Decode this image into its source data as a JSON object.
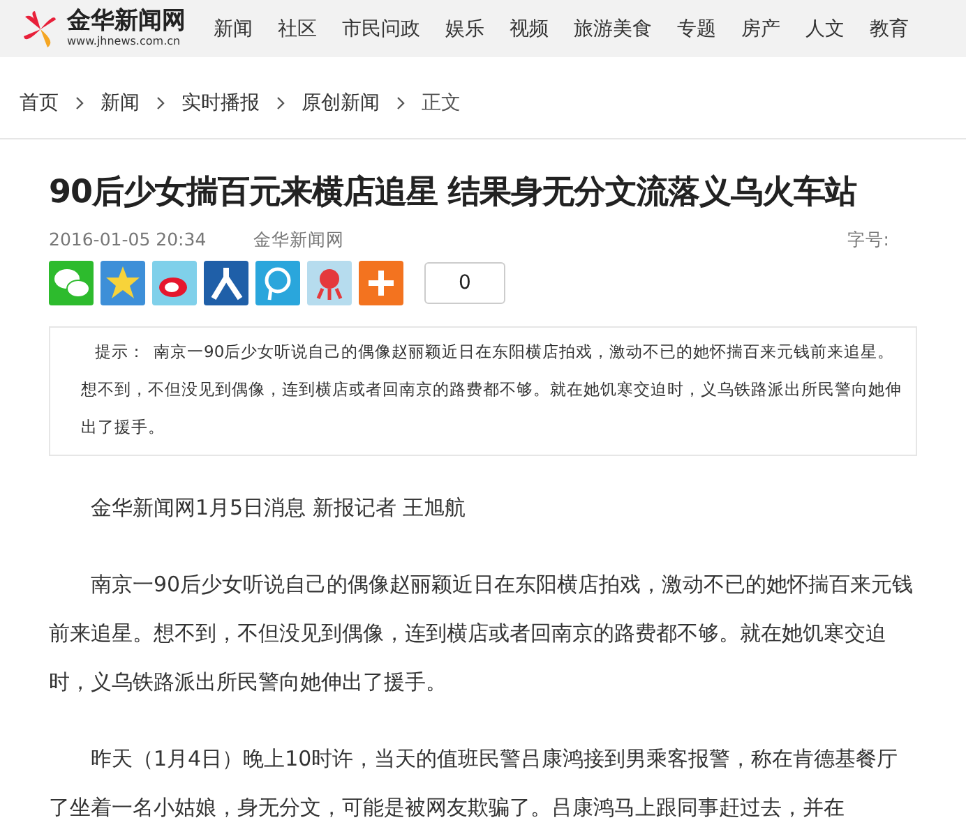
{
  "logo": {
    "name": "金华新闻网",
    "url": "www.jhnews.com.cn"
  },
  "nav": [
    "新闻",
    "社区",
    "市民问政",
    "娱乐",
    "视频",
    "旅游美食",
    "专题",
    "房产",
    "人文",
    "教育"
  ],
  "breadcrumb": [
    "首页",
    "新闻",
    "实时播报",
    "原创新闻",
    "正文"
  ],
  "article": {
    "title": "90后少女揣百元来横店追星 结果身无分文流落义乌火车站",
    "date": "2016-01-05 20:34",
    "source": "金华新闻网",
    "font_size_label": "字号:",
    "share": [
      {
        "kind": "wechat"
      },
      {
        "kind": "qzone"
      },
      {
        "kind": "weibo"
      },
      {
        "kind": "renren"
      },
      {
        "kind": "tqq"
      },
      {
        "kind": "tsohu"
      },
      {
        "kind": "more"
      }
    ],
    "share_count": "0",
    "summary": {
      "label": "提示：",
      "text": "南京一90后少女听说自己的偶像赵丽颖近日在东阳横店拍戏，激动不已的她怀揣百来元钱前来追星。想不到，不但没见到偶像，连到横店或者回南京的路费都不够。就在她饥寒交迫时，义乌铁路派出所民警向她伸出了援手。"
    },
    "paragraphs": [
      "金华新闻网1月5日消息 新报记者 王旭航",
      "南京一90后少女听说自己的偶像赵丽颖近日在东阳横店拍戏，激动不已的她怀揣百来元钱前来追星。想不到，不但没见到偶像，连到横店或者回南京的路费都不够。就在她饥寒交迫时，义乌铁路派出所民警向她伸出了援手。",
      "昨天（1月4日）晚上10时许，当天的值班民警吕康鸿接到男乘客报警，称在肯德基餐厅了坐着一名小姑娘，身无分文，可能是被网友欺骗了。吕康鸿马上跟同事赶过去，并在"
    ]
  }
}
